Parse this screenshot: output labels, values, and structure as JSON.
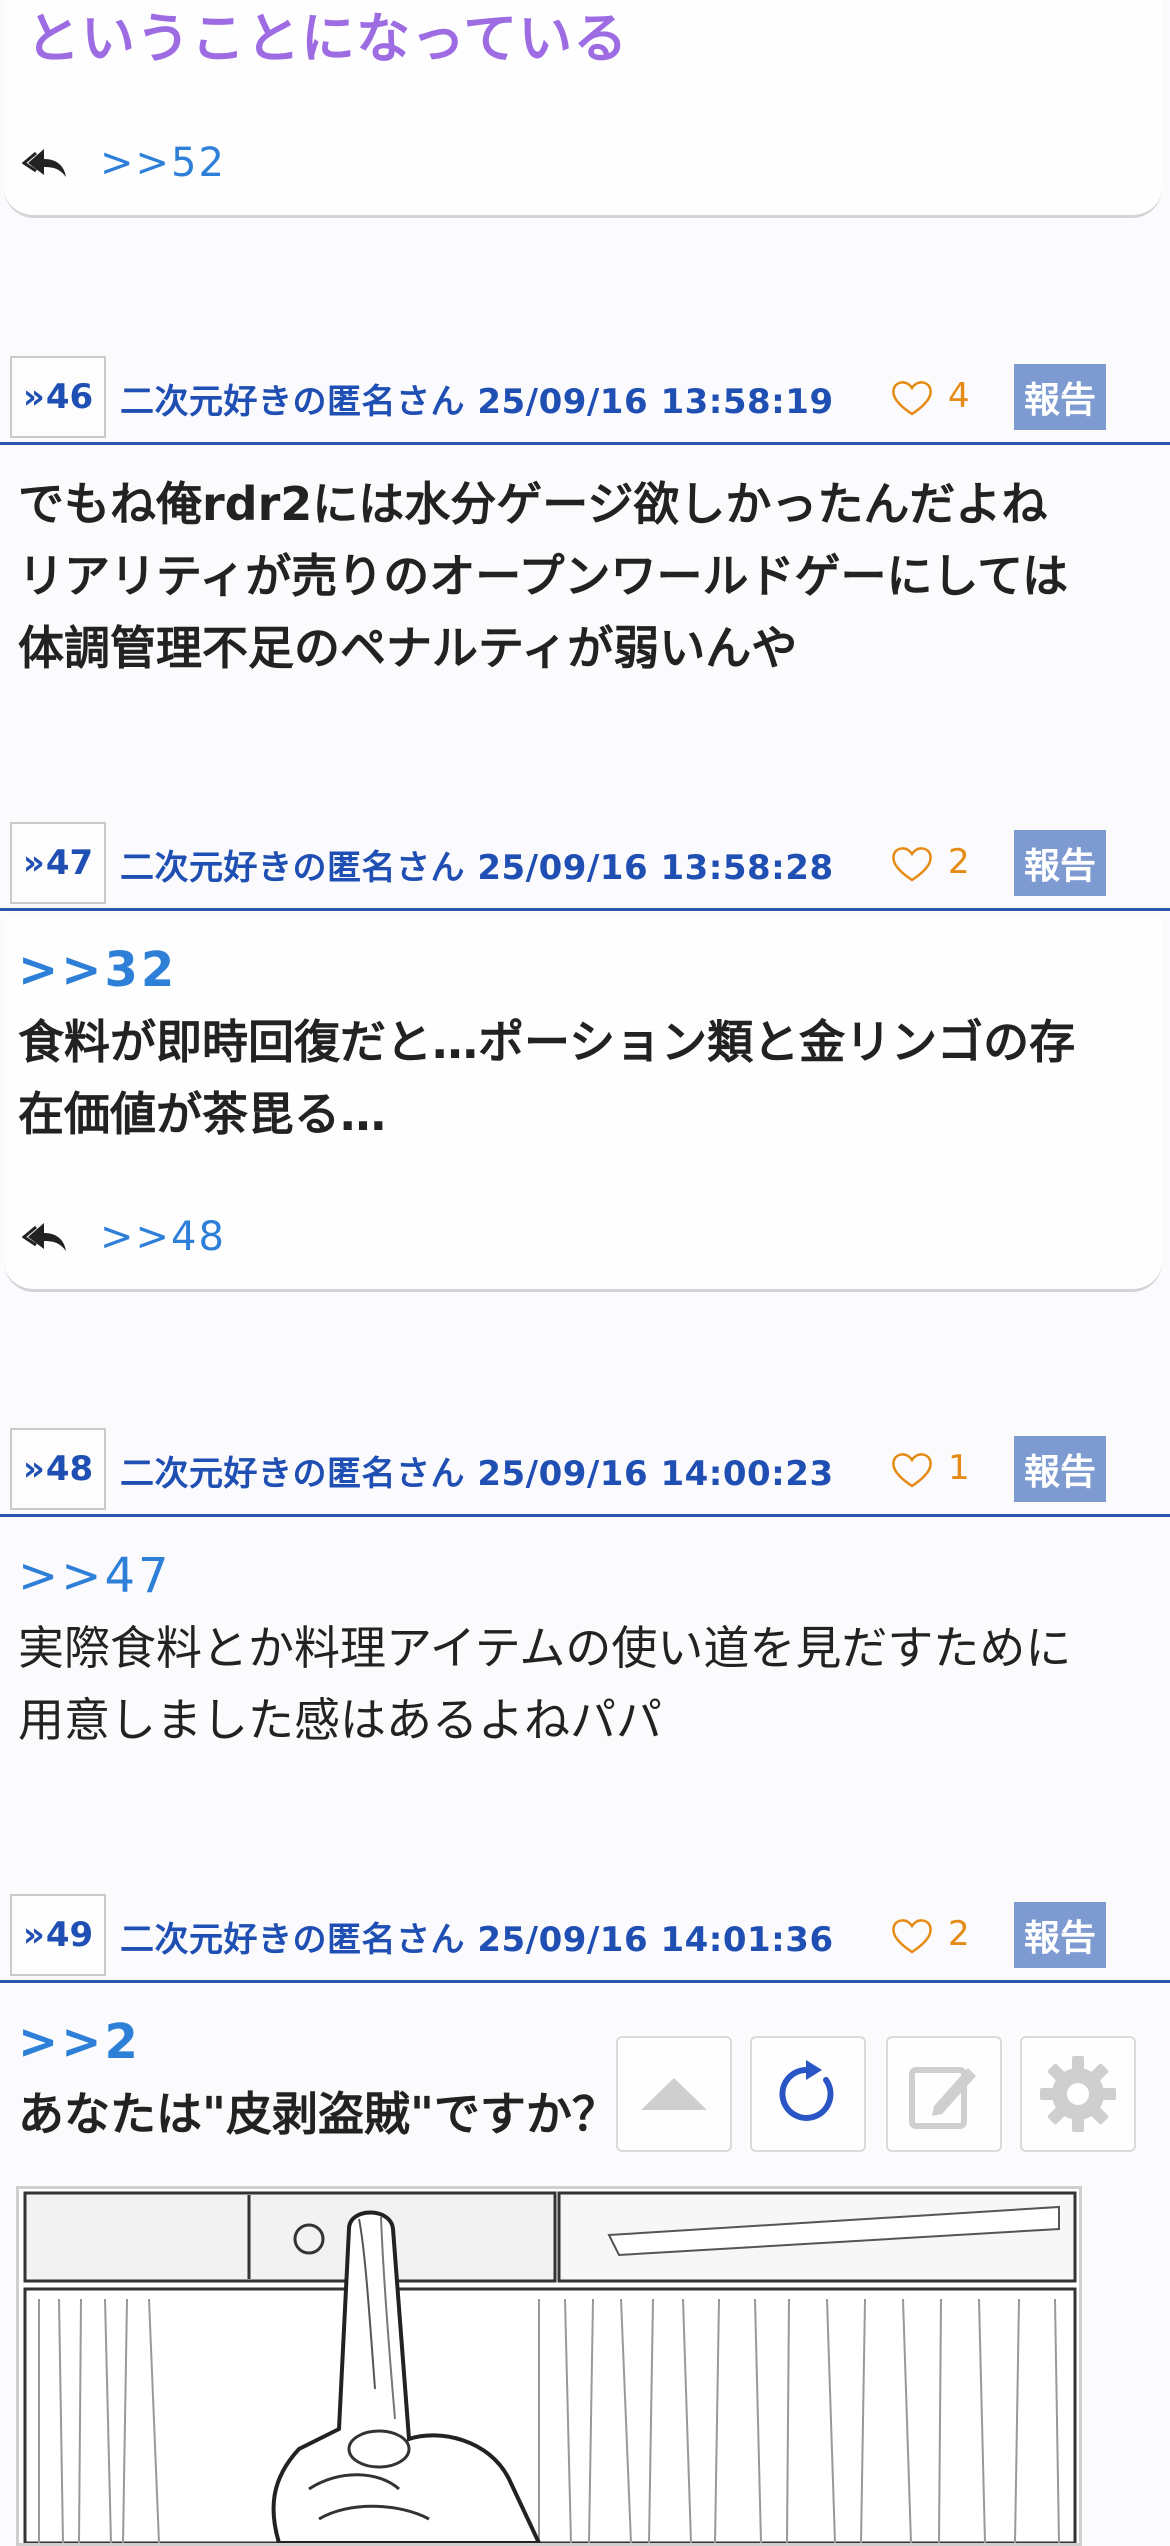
{
  "prev_post": {
    "tail_text": "ということになっている",
    "reply_link": ">>52"
  },
  "posts": [
    {
      "number": "46",
      "author": "二次元好きの匿名さん",
      "datetime": "25/09/16 13:58:19",
      "likes": "4",
      "report_label": "報告",
      "lines": [
        "でもね俺rdr2には水分ゲージ欲しかったんだよね",
        "リアリティが売りのオープンワールドゲーにしては",
        "体調管理不足のペナルティが弱いんや"
      ]
    },
    {
      "number": "47",
      "author": "二次元好きの匿名さん",
      "datetime": "25/09/16 13:58:28",
      "likes": "2",
      "report_label": "報告",
      "anchor": ">>32",
      "lines": [
        "食料が即時回復だと…ポーション類と金リンゴの存",
        "在価値が茶毘る…"
      ],
      "reply_link": ">>48"
    },
    {
      "number": "48",
      "author": "二次元好きの匿名さん",
      "datetime": "25/09/16 14:00:23",
      "likes": "1",
      "report_label": "報告",
      "anchor": ">>47",
      "lines": [
        "実際食料とか料理アイテムの使い道を見だすために",
        "用意しました感はあるよねパパ"
      ]
    },
    {
      "number": "49",
      "author": "二次元好きの匿名さん",
      "datetime": "25/09/16 14:01:36",
      "likes": "2",
      "report_label": "報告",
      "anchor": ">>2",
      "lines": [
        "あなたは\"皮剥盗賊\"ですか？"
      ]
    }
  ],
  "toolbar": {
    "icons": [
      "scroll-top-icon",
      "refresh-icon",
      "edit-icon",
      "settings-icon"
    ]
  },
  "colors": {
    "accent_blue": "#1f4fb3",
    "link_blue": "#2d7fd8",
    "purple": "#9d6ce3",
    "like_orange": "#e58a14",
    "report_bg": "#7d9bd0"
  }
}
